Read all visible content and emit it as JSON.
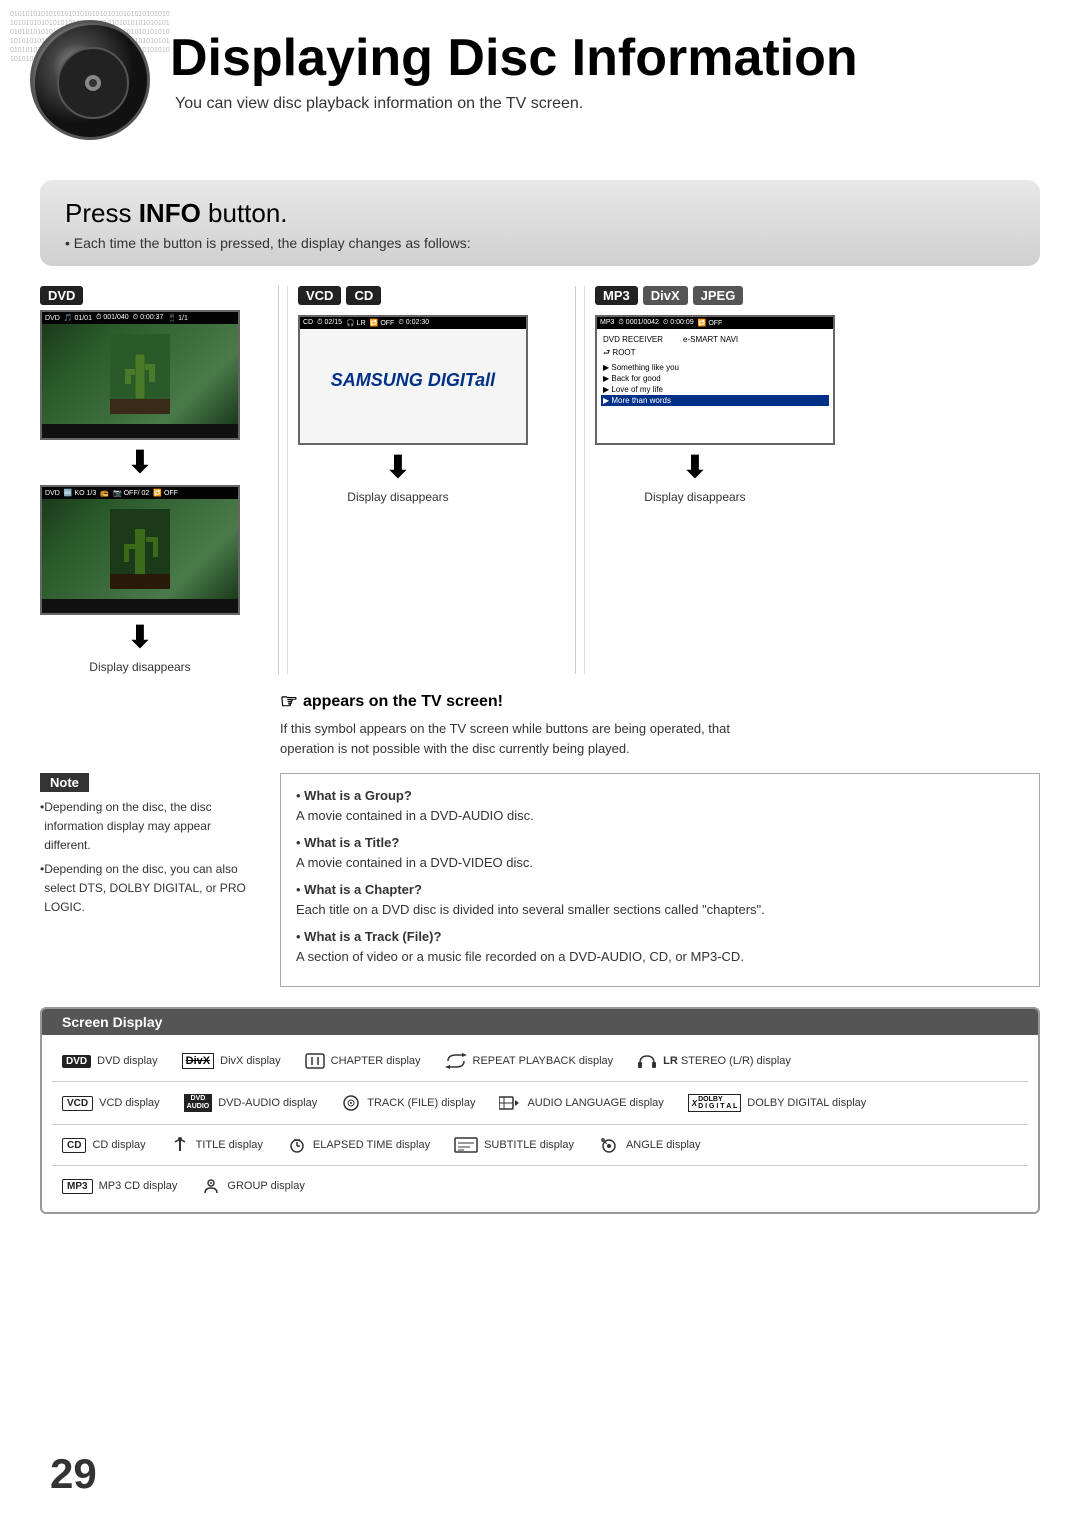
{
  "page": {
    "number": "29",
    "title": "Displaying Disc Information",
    "subtitle": "You can view disc playback information  on the TV screen."
  },
  "info_section": {
    "title_prefix": "Press ",
    "title_bold": "INFO",
    "title_suffix": " button.",
    "subtitle": "Each time the button is pressed, the display changes as follows:"
  },
  "dvd_column": {
    "label": "DVD",
    "screen1_info": "DVD  01/01  001/040  0:00:37  1/1",
    "screen2_info": "DVD  KO 1/3  OFF/ 02  OFF",
    "arrow1": "↓",
    "arrow2": "↓",
    "display_disappears": "Display disappears"
  },
  "vcd_column": {
    "labels": [
      "VCD",
      "CD"
    ],
    "screen_info": "CD  02/15  LR  OFF  0:02:30",
    "samsung_logo": "SAMSUNG DIGITall",
    "arrow": "↓",
    "display_disappears": "Display disappears"
  },
  "mp3_column": {
    "labels": [
      "MP3",
      "DivX",
      "JPEG"
    ],
    "screen_info": "MP3  0001/0042  0:00:09  OFF",
    "rows": [
      {
        "text": "DVD RECEIVER",
        "sub": "e-SMART NAVI",
        "selected": false
      },
      {
        "text": "ROOT",
        "selected": false
      },
      {
        "text": "Something like you",
        "selected": false
      },
      {
        "text": "Back for good",
        "selected": false
      },
      {
        "text": "Love of my life",
        "selected": false
      },
      {
        "text": "More than words",
        "selected": true
      }
    ],
    "arrow": "↓",
    "display_disappears": "Display disappears"
  },
  "appears_section": {
    "title": " appears on the TV screen!",
    "text1": "If this symbol appears on the TV screen while buttons are being operated, that",
    "text2": "operation is not possible with the disc currently being played."
  },
  "note_section": {
    "label": "Note",
    "bullets": [
      "Depending on the disc, the disc information display may appear different.",
      "Depending on the disc, you can also select DTS, DOLBY DIGITAL, or PRO LOGIC."
    ]
  },
  "whatis_section": {
    "items": [
      {
        "label": "What is a Group?",
        "text": "A movie contained in a DVD-AUDIO disc."
      },
      {
        "label": "What is a Title?",
        "text": "A movie contained in a DVD-VIDEO disc."
      },
      {
        "label": "What is a Chapter?",
        "text": "Each title on a DVD disc is divided into several smaller sections called \"chapters\"."
      },
      {
        "label": "What is a Track (File)?",
        "text": "A section of video or a music file recorded on a DVD-AUDIO, CD, or MP3-CD."
      }
    ]
  },
  "screen_display": {
    "header": "Screen Display",
    "rows": [
      [
        {
          "badge": "DVD",
          "badge_style": "filled",
          "text": "DVD display"
        },
        {
          "badge": "DivX",
          "badge_style": "strikethrough",
          "text": "DivX display"
        },
        {
          "icon": "chapter",
          "text": "CHAPTER display"
        },
        {
          "icon": "repeat",
          "text": "REPEAT PLAYBACK display"
        },
        {
          "icon": "headphone",
          "text": "LR  STEREO (L/R) display"
        }
      ],
      [
        {
          "badge": "VCD",
          "badge_style": "outline",
          "text": "VCD display"
        },
        {
          "badge": "DVD AUDIO",
          "badge_style": "filled",
          "text": "DVD-AUDIO display"
        },
        {
          "icon": "track",
          "text": "TRACK (FILE) display"
        },
        {
          "icon": "audio-lang",
          "text": "AUDIO LANGUAGE display"
        },
        {
          "icon": "dolby",
          "text": "DOLBY DIGITAL display"
        }
      ],
      [
        {
          "badge": "CD",
          "badge_style": "outline",
          "text": "CD display"
        },
        {
          "icon": "title",
          "text": "TITLE display"
        },
        {
          "icon": "elapsed",
          "text": "ELAPSED TIME display"
        },
        {
          "icon": "subtitle",
          "text": "SUBTITLE display"
        },
        {
          "icon": "angle",
          "text": "ANGLE display"
        }
      ],
      [
        {
          "badge": "MP3",
          "badge_style": "outline",
          "text": "MP3 CD display"
        },
        {
          "icon": "group",
          "text": "GROUP display"
        }
      ]
    ]
  }
}
